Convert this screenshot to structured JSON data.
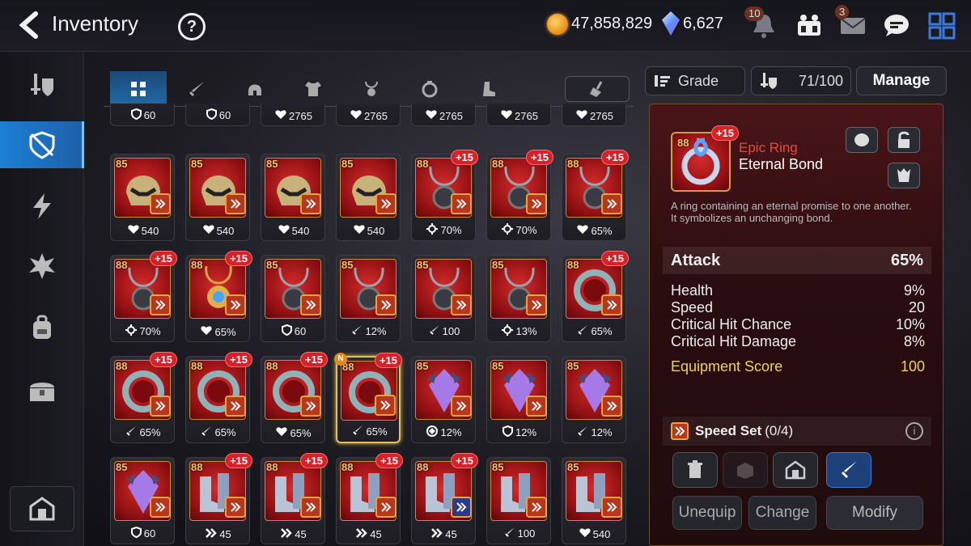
{
  "header": {
    "title": "Inventory",
    "help": "?",
    "gold": "47,858,829",
    "crystals": "6,627",
    "notif_count": "10",
    "mail_count": "3"
  },
  "colors": {
    "accent": "#1f7ad0",
    "grade_text": "#e84a3a",
    "score": "#f3d24a",
    "selected_border": "#e2c15a"
  },
  "sidebar": {
    "items": [
      {
        "icon": "equipment-icon",
        "active": false
      },
      {
        "icon": "shield-cross-icon",
        "active": true
      },
      {
        "icon": "lightning-icon",
        "active": false
      },
      {
        "icon": "spiky-icon",
        "active": false
      },
      {
        "icon": "backpack-icon",
        "active": false
      },
      {
        "icon": "chest-icon",
        "active": false
      }
    ],
    "bottom_icon": "storehouse-icon"
  },
  "filter_tabs": [
    "all-icon",
    "weapon-icon",
    "helmet-icon",
    "armor-icon",
    "necklace-icon",
    "ring-icon",
    "boots-icon"
  ],
  "controls": {
    "grade_label": "Grade",
    "capacity": "71/100",
    "manage_label": "Manage"
  },
  "grid": {
    "top_row": [
      {
        "stat_icon": "shield",
        "value": "60"
      },
      {
        "stat_icon": "shield",
        "value": "60"
      },
      {
        "stat_icon": "heart",
        "value": "2765"
      },
      {
        "stat_icon": "heart",
        "value": "2765"
      },
      {
        "stat_icon": "heart",
        "value": "2765"
      },
      {
        "stat_icon": "heart",
        "value": "2765"
      },
      {
        "stat_icon": "heart",
        "value": "2765"
      }
    ],
    "rows": [
      [
        {
          "level": "85",
          "plus": "",
          "kind": "helmet",
          "stat_icon": "heart",
          "value": "540"
        },
        {
          "level": "85",
          "plus": "",
          "kind": "helmet",
          "stat_icon": "heart",
          "value": "540"
        },
        {
          "level": "85",
          "plus": "",
          "kind": "helmet",
          "stat_icon": "heart",
          "value": "540"
        },
        {
          "level": "85",
          "plus": "",
          "kind": "helmet",
          "stat_icon": "heart",
          "value": "540"
        },
        {
          "level": "88",
          "plus": "+15",
          "kind": "necklace",
          "stat_icon": "crit",
          "value": "70%"
        },
        {
          "level": "88",
          "plus": "+15",
          "kind": "necklace",
          "stat_icon": "crit",
          "value": "70%"
        },
        {
          "level": "88",
          "plus": "+15",
          "kind": "necklace",
          "stat_icon": "heart",
          "value": "65%"
        }
      ],
      [
        {
          "level": "88",
          "plus": "+15",
          "kind": "necklace",
          "stat_icon": "crit",
          "value": "70%"
        },
        {
          "level": "88",
          "plus": "+15",
          "kind": "amulet",
          "stat_icon": "heart",
          "value": "65%"
        },
        {
          "level": "85",
          "plus": "",
          "kind": "necklace",
          "stat_icon": "shield",
          "value": "60"
        },
        {
          "level": "85",
          "plus": "",
          "kind": "necklace",
          "stat_icon": "sword",
          "value": "12%"
        },
        {
          "level": "85",
          "plus": "",
          "kind": "necklace",
          "stat_icon": "sword",
          "value": "100"
        },
        {
          "level": "85",
          "plus": "",
          "kind": "necklace",
          "stat_icon": "crit",
          "value": "13%"
        },
        {
          "level": "88",
          "plus": "+15",
          "kind": "ring",
          "stat_icon": "sword",
          "value": "65%"
        }
      ],
      [
        {
          "level": "88",
          "plus": "+15",
          "kind": "ring",
          "stat_icon": "sword",
          "value": "65%"
        },
        {
          "level": "88",
          "plus": "+15",
          "kind": "ring",
          "stat_icon": "sword",
          "value": "65%"
        },
        {
          "level": "88",
          "plus": "+15",
          "kind": "ring",
          "stat_icon": "heart",
          "value": "65%"
        },
        {
          "level": "88",
          "plus": "+15",
          "kind": "ring",
          "stat_icon": "sword",
          "value": "65%",
          "selected": true,
          "new": "N"
        },
        {
          "level": "85",
          "plus": "",
          "kind": "gem",
          "stat_icon": "effect",
          "value": "12%"
        },
        {
          "level": "85",
          "plus": "",
          "kind": "gem",
          "stat_icon": "shield",
          "value": "12%"
        },
        {
          "level": "85",
          "plus": "",
          "kind": "gem",
          "stat_icon": "sword",
          "value": "12%"
        }
      ],
      [
        {
          "level": "85",
          "plus": "",
          "kind": "gem",
          "stat_icon": "shield",
          "value": "60"
        },
        {
          "level": "88",
          "plus": "+15",
          "kind": "boots",
          "stat_icon": "speed",
          "value": "45"
        },
        {
          "level": "88",
          "plus": "+15",
          "kind": "boots",
          "stat_icon": "speed",
          "value": "45"
        },
        {
          "level": "88",
          "plus": "+15",
          "kind": "boots",
          "stat_icon": "speed",
          "value": "45"
        },
        {
          "level": "88",
          "plus": "+15",
          "kind": "boots",
          "stat_icon": "speed",
          "value": "45"
        },
        {
          "level": "85",
          "plus": "",
          "kind": "boots",
          "stat_icon": "sword",
          "value": "100"
        },
        {
          "level": "85",
          "plus": "",
          "kind": "boots",
          "stat_icon": "heart",
          "value": "540"
        }
      ]
    ]
  },
  "detail": {
    "level": "88",
    "plus": "+15",
    "grade": "Epic Ring",
    "name": "Eternal Bond",
    "description_1": "A ring containing an eternal promise to one another.",
    "description_2": "It symbolizes an unchanging bond.",
    "main_stat": {
      "label": "Attack",
      "value": "65%"
    },
    "substats": [
      {
        "label": "Health",
        "value": "9%"
      },
      {
        "label": "Speed",
        "value": "20"
      },
      {
        "label": "Critical Hit Chance",
        "value": "10%"
      },
      {
        "label": "Critical Hit Damage",
        "value": "8%"
      }
    ],
    "score_label": "Equipment Score",
    "score_value": "100",
    "set_label": "Speed Set",
    "set_count": "(0/4)",
    "info": "i",
    "buttons": {
      "unequip": "Unequip",
      "change": "Change",
      "modify": "Modify"
    }
  }
}
